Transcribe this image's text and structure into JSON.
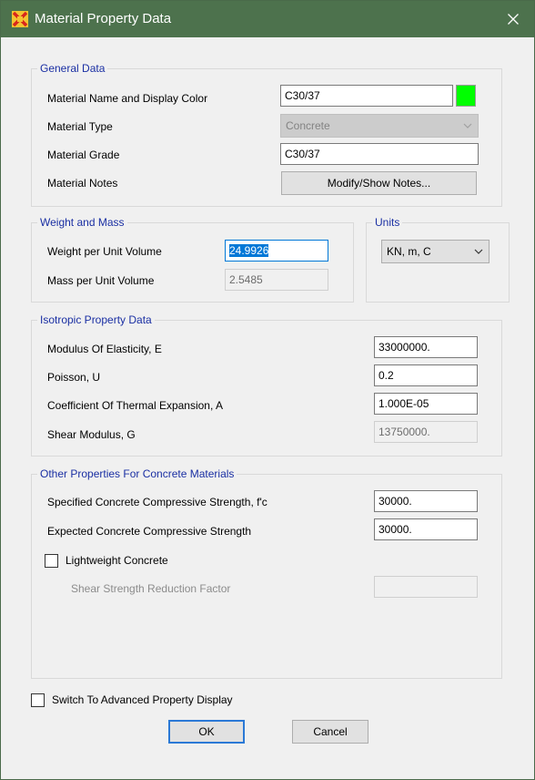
{
  "window": {
    "title": "Material Property Data"
  },
  "general": {
    "title": "General Data",
    "name_label": "Material Name and Display Color",
    "name_value": "C30/37",
    "display_color": "#00ff00",
    "type_label": "Material Type",
    "type_value": "Concrete",
    "grade_label": "Material Grade",
    "grade_value": "C30/37",
    "notes_label": "Material Notes",
    "notes_button": "Modify/Show Notes..."
  },
  "weight": {
    "title": "Weight and Mass",
    "weight_label": "Weight per Unit Volume",
    "weight_value": "24.9926",
    "mass_label": "Mass per Unit Volume",
    "mass_value": "2.5485"
  },
  "units": {
    "title": "Units",
    "value": "KN, m, C"
  },
  "isotropic": {
    "title": "Isotropic Property Data",
    "e_label": "Modulus Of Elasticity,  E",
    "e_value": "33000000.",
    "u_label": "Poisson,  U",
    "u_value": "0.2",
    "a_label": "Coefficient Of Thermal Expansion,  A",
    "a_value": "1.000E-05",
    "g_label": "Shear Modulus,  G",
    "g_value": "13750000."
  },
  "concrete": {
    "title": "Other Properties For Concrete Materials",
    "fc_label": "Specified Concrete Compressive Strength, f'c",
    "fc_value": "30000.",
    "expected_label": "Expected Concrete Compressive Strength",
    "expected_value": "30000.",
    "lightweight_label": "Lightweight Concrete",
    "shear_reduction_label": "Shear Strength Reduction Factor",
    "shear_reduction_value": ""
  },
  "footer": {
    "advanced_label": "Switch To Advanced Property Display",
    "ok_label": "OK",
    "cancel_label": "Cancel"
  },
  "colors": {
    "titlebar": "#4d724d",
    "group_title": "#1a2fa3",
    "selection": "#0078d7"
  }
}
